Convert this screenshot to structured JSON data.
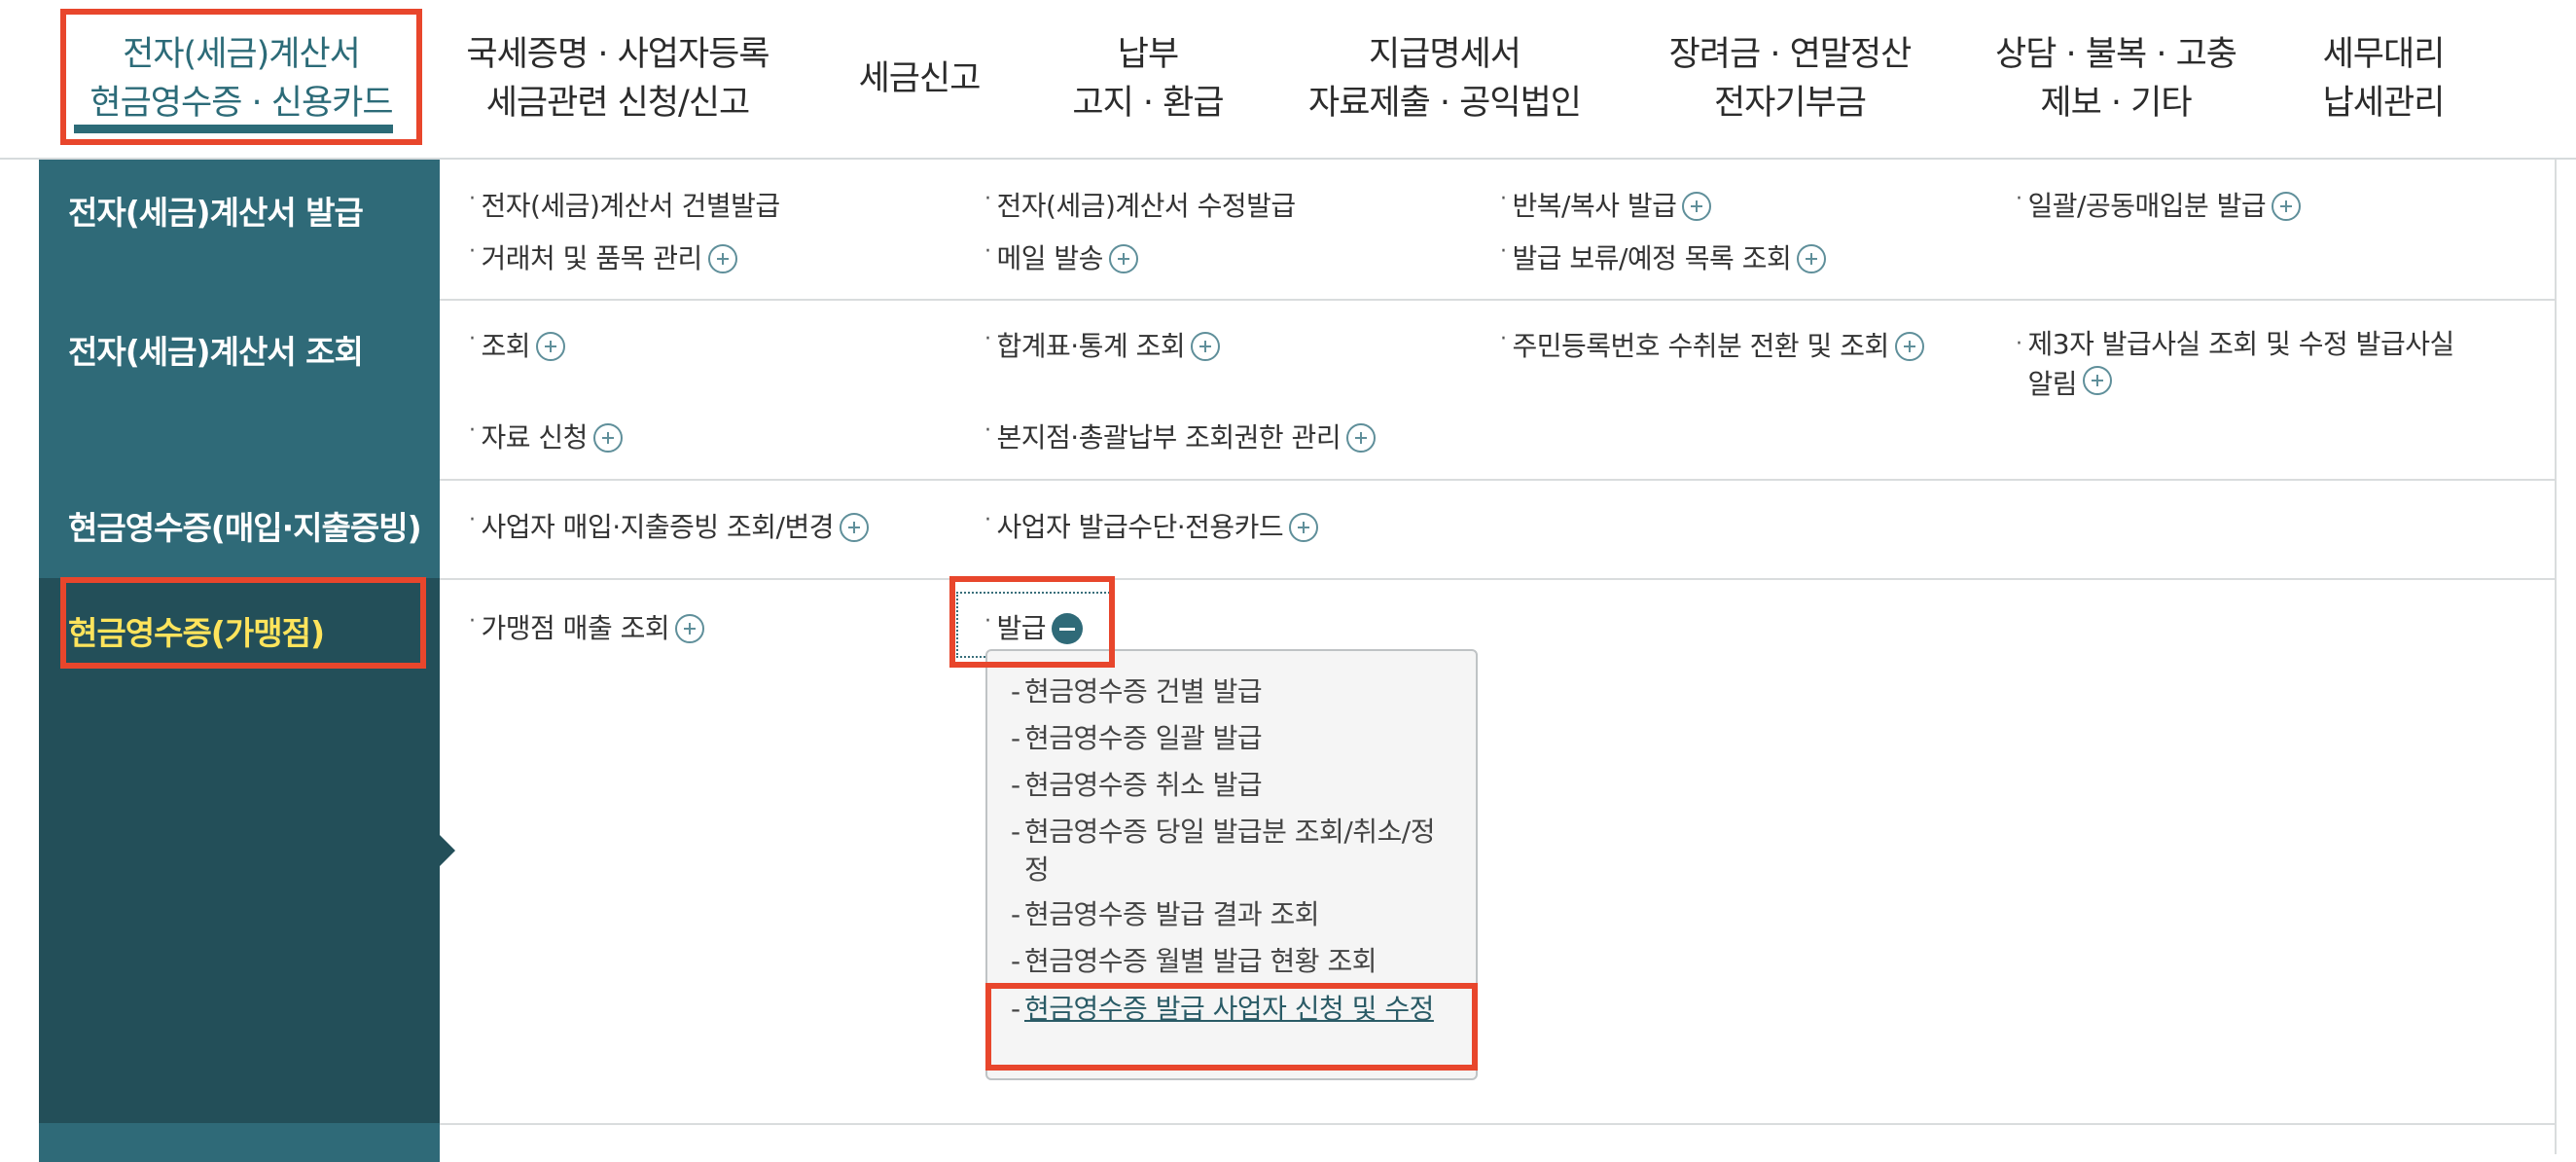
{
  "nav": {
    "items": [
      {
        "line1": "전자(세금)계산서",
        "line2": "현금영수증 · 신용카드",
        "active": true
      },
      {
        "line1": "국세증명 · 사업자등록",
        "line2": "세금관련 신청/신고"
      },
      {
        "line1": "세금신고",
        "line2": ""
      },
      {
        "line1": "납부",
        "line2": "고지 · 환급"
      },
      {
        "line1": "지급명세서",
        "line2": "자료제출 · 공익법인"
      },
      {
        "line1": "장려금 · 연말정산",
        "line2": "전자기부금"
      },
      {
        "line1": "상담 · 불복 · 고충",
        "line2": "제보 · 기타"
      },
      {
        "line1": "세무대리",
        "line2": "납세관리"
      }
    ]
  },
  "rows": [
    {
      "title": "전자(세금)계산서 발급",
      "links": [
        "전자(세금)계산서 건별발급",
        "전자(세금)계산서 수정발급",
        "반복/복사 발급",
        "일괄/공동매입분 발급",
        "거래처 및 품목 관리",
        "메일 발송",
        "발급 보류/예정 목록 조회"
      ]
    },
    {
      "title": "전자(세금)계산서 조회",
      "links": [
        "조회",
        "합계표·통계 조회",
        "주민등록번호 수취분 전환 및 조회",
        "제3자 발급사실 조회 및 수정 발급사실 알림",
        "자료 신청",
        "본지점·총괄납부 조회권한 관리"
      ]
    },
    {
      "title": "현금영수증(매입·지출증빙)",
      "links": [
        "사업자 매입·지출증빙 조회/변경",
        "사업자 발급수단·전용카드"
      ]
    },
    {
      "title": "현금영수증(가맹점)",
      "links": [
        "가맹점 매출 조회",
        "발급"
      ],
      "submenu": [
        "현금영수증 건별 발급",
        "현금영수증 일괄 발급",
        "현금영수증 취소 발급",
        "현금영수증 당일 발급분 조회/취소/정정",
        "현금영수증 발급 결과 조회",
        "현금영수증 월별 발급 현황 조회",
        "현금영수증 발급 사업자 신청 및 수정"
      ]
    }
  ],
  "colors": {
    "teal": "#2f6a78",
    "teal_dark": "#234f59",
    "highlight": "#e8462c",
    "selected_text": "#ffe45c"
  }
}
